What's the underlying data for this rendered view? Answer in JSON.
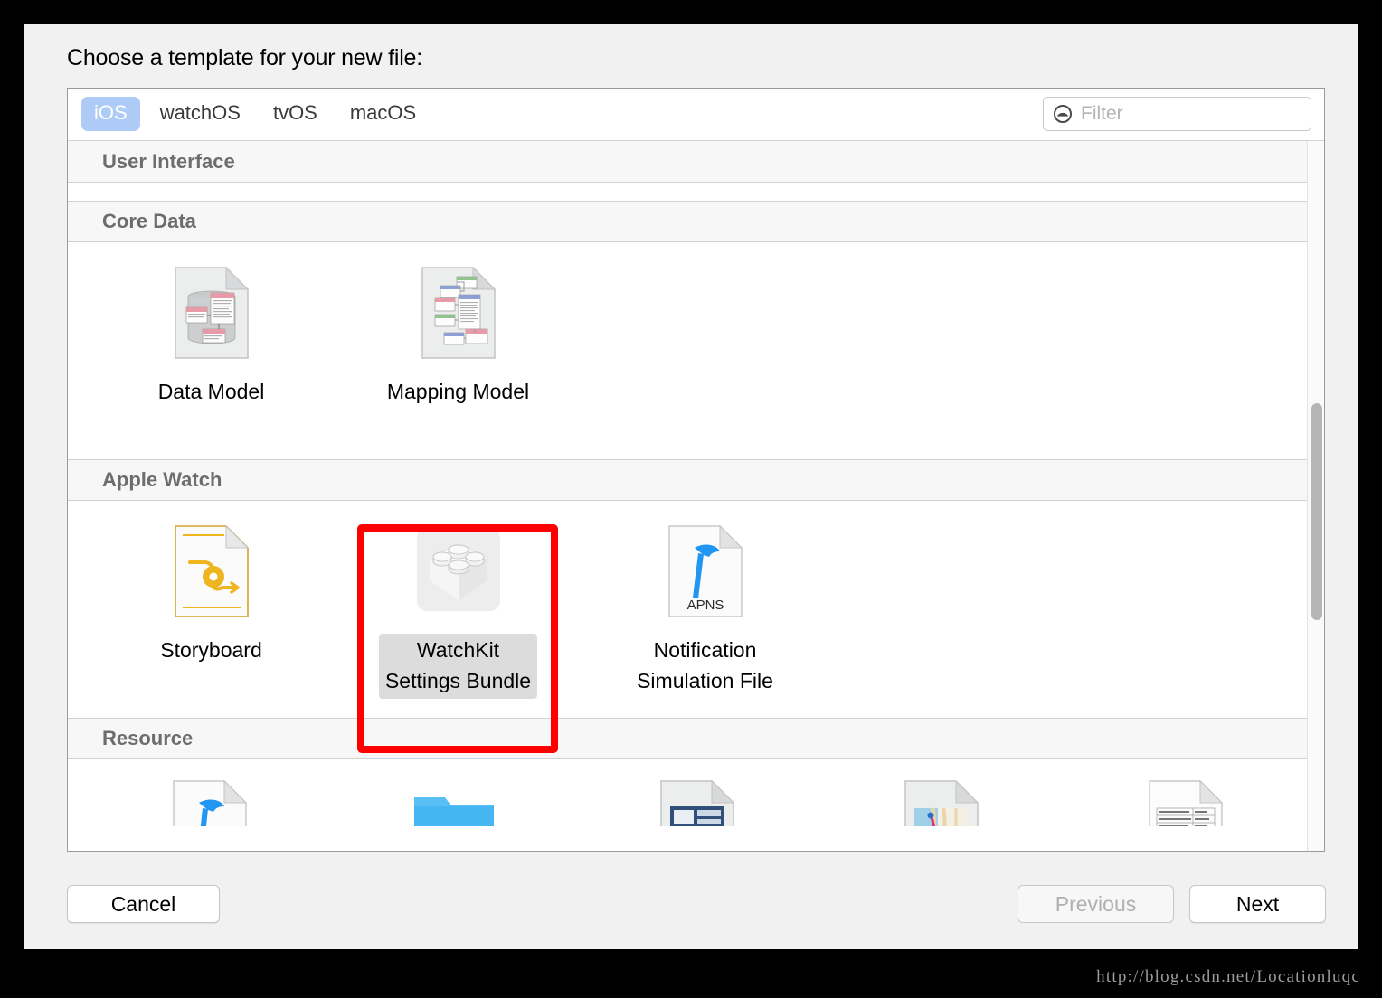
{
  "dialog": {
    "title": "Choose a template for your new file:"
  },
  "toolbar": {
    "tabs": [
      {
        "label": "iOS",
        "active": true
      },
      {
        "label": "watchOS",
        "active": false
      },
      {
        "label": "tvOS",
        "active": false
      },
      {
        "label": "macOS",
        "active": false
      }
    ],
    "filter": {
      "placeholder": "Filter",
      "value": "",
      "icon": "filter-circle-icon"
    }
  },
  "sections": [
    {
      "header": "User Interface",
      "items": []
    },
    {
      "header": "Core Data",
      "items": [
        {
          "label": "Data Model",
          "icon": "data-model-icon",
          "selected": false
        },
        {
          "label": "Mapping Model",
          "icon": "mapping-model-icon",
          "selected": false
        }
      ]
    },
    {
      "header": "Apple Watch",
      "items": [
        {
          "label": "Storyboard",
          "icon": "storyboard-icon",
          "selected": false
        },
        {
          "label": "WatchKit\nSettings Bundle",
          "icon": "settings-bundle-icon",
          "selected": true
        },
        {
          "label": "Notification\nSimulation File",
          "icon": "apns-file-icon",
          "selected": false
        }
      ]
    },
    {
      "header": "Resource",
      "items": [
        {
          "label": "",
          "icon": "hammer-file-icon",
          "selected": false
        },
        {
          "label": "",
          "icon": "blue-folder-icon",
          "selected": false
        },
        {
          "label": "",
          "icon": "map-pin-file-icon",
          "selected": false
        },
        {
          "label": "",
          "icon": "gpx-map-file-icon",
          "selected": false
        },
        {
          "label": "",
          "icon": "plist-table-file-icon",
          "selected": false
        }
      ]
    }
  ],
  "footer": {
    "cancel_label": "Cancel",
    "previous_label": "Previous",
    "next_label": "Next"
  },
  "watermark": "http://blog.csdn.net/Locationluqc",
  "colors": {
    "accent_tab": "#aecbf7",
    "highlight_box": "#ff0000",
    "selection_bg": "#dcdcdc",
    "section_header_text": "#6d6d6d",
    "dialog_bg": "#f1f1f1"
  }
}
